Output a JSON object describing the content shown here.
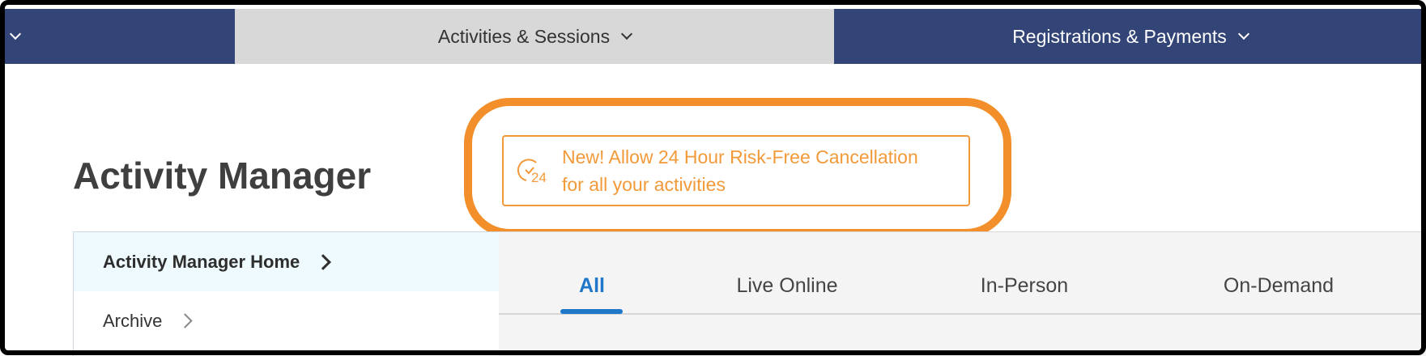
{
  "topnav": {
    "items": [
      {
        "label": "Activities & Sessions"
      },
      {
        "label": "Registrations & Payments"
      }
    ]
  },
  "page": {
    "title": "Activity Manager"
  },
  "promo": {
    "line1": "New! Allow 24 Hour Risk-Free Cancellation",
    "line2": "for all your activities",
    "icon_text": "24",
    "color": "#f29a3a",
    "highlight_color": "#f28f2a"
  },
  "sidebar": {
    "items": [
      {
        "label": "Activity Manager Home",
        "active": true
      },
      {
        "label": "Archive",
        "active": false
      }
    ]
  },
  "tabs": {
    "items": [
      {
        "label": "All",
        "active": true
      },
      {
        "label": "Live Online"
      },
      {
        "label": "In-Person"
      },
      {
        "label": "On-Demand"
      }
    ]
  },
  "colors": {
    "nav_bg": "#334476",
    "accent": "#1f77c9"
  }
}
